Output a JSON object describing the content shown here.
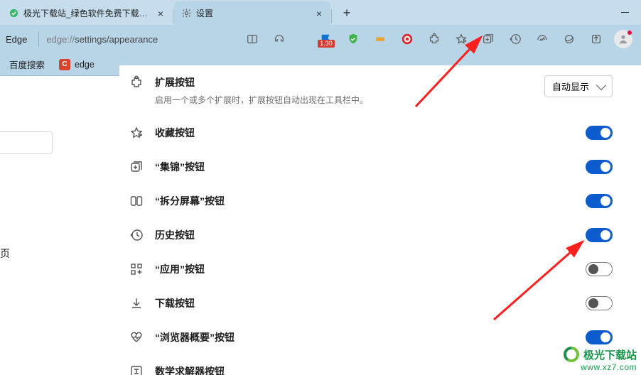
{
  "tabs": [
    {
      "title": "极光下载站_绿色软件免费下载_…",
      "favicon_color": "#39b86b"
    },
    {
      "title": "设置"
    }
  ],
  "window": {
    "new_tab_glyph": "+",
    "close_glyph": "×",
    "minimize_label": "—"
  },
  "toolbar": {
    "left_label": "Edge",
    "url_prefix": "edge://",
    "url_rest": "settings/appearance",
    "flag_badge": "1.30"
  },
  "bookmarks": [
    {
      "label": "百度搜索"
    },
    {
      "label": "edge",
      "fav_bg": "#d7452d",
      "fav_text": "C"
    }
  ],
  "leftpanel": {
    "cropped_text": "页"
  },
  "settings": [
    {
      "key": "extensions",
      "title": "扩展按钮",
      "desc": "启用一个或多个扩展时，扩展按钮自动出现在工具栏中。",
      "control": "dropdown",
      "dropdown_value": "自动显示"
    },
    {
      "key": "favorites",
      "title": "收藏按钮",
      "control": "toggle",
      "on": true
    },
    {
      "key": "collections",
      "title": "“集锦”按钮",
      "control": "toggle",
      "on": true
    },
    {
      "key": "split",
      "title": "“拆分屏幕”按钮",
      "control": "toggle",
      "on": true
    },
    {
      "key": "history",
      "title": "历史按钮",
      "control": "toggle",
      "on": true
    },
    {
      "key": "apps",
      "title": "“应用”按钮",
      "control": "toggle",
      "on": false
    },
    {
      "key": "downloads",
      "title": "下载按钮",
      "control": "toggle",
      "on": false
    },
    {
      "key": "perf",
      "title": "“浏览器概要”按钮",
      "control": "toggle",
      "on": true
    },
    {
      "key": "math",
      "title": "数学求解器按钮",
      "control": "toggle",
      "on": false
    }
  ],
  "watermark": {
    "line1": "极光下载站",
    "line2": "www.xz7.com"
  }
}
